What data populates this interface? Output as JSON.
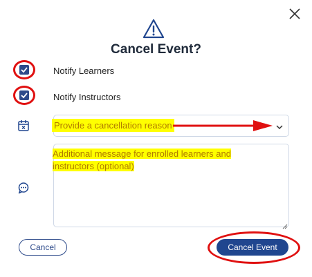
{
  "dialog": {
    "title": "Cancel Event?",
    "close_icon": "close-icon",
    "warning_icon": "warning-icon"
  },
  "options": {
    "notify_learners": {
      "label": "Notify Learners",
      "checked": true
    },
    "notify_instructors": {
      "label": "Notify Instructors",
      "checked": true
    }
  },
  "reason": {
    "icon": "calendar-x-icon",
    "placeholder": "Provide a cancellation reason",
    "chevron_icon": "chevron-down-icon"
  },
  "message": {
    "icon": "chat-bubble-icon",
    "placeholder": "Additional message for enrolled learners and instructors (optional)"
  },
  "buttons": {
    "cancel": "Cancel",
    "confirm": "Cancel Event"
  },
  "colors": {
    "primary": "#20468f",
    "annotation_red": "#e01010",
    "highlight": "#ffff00"
  }
}
